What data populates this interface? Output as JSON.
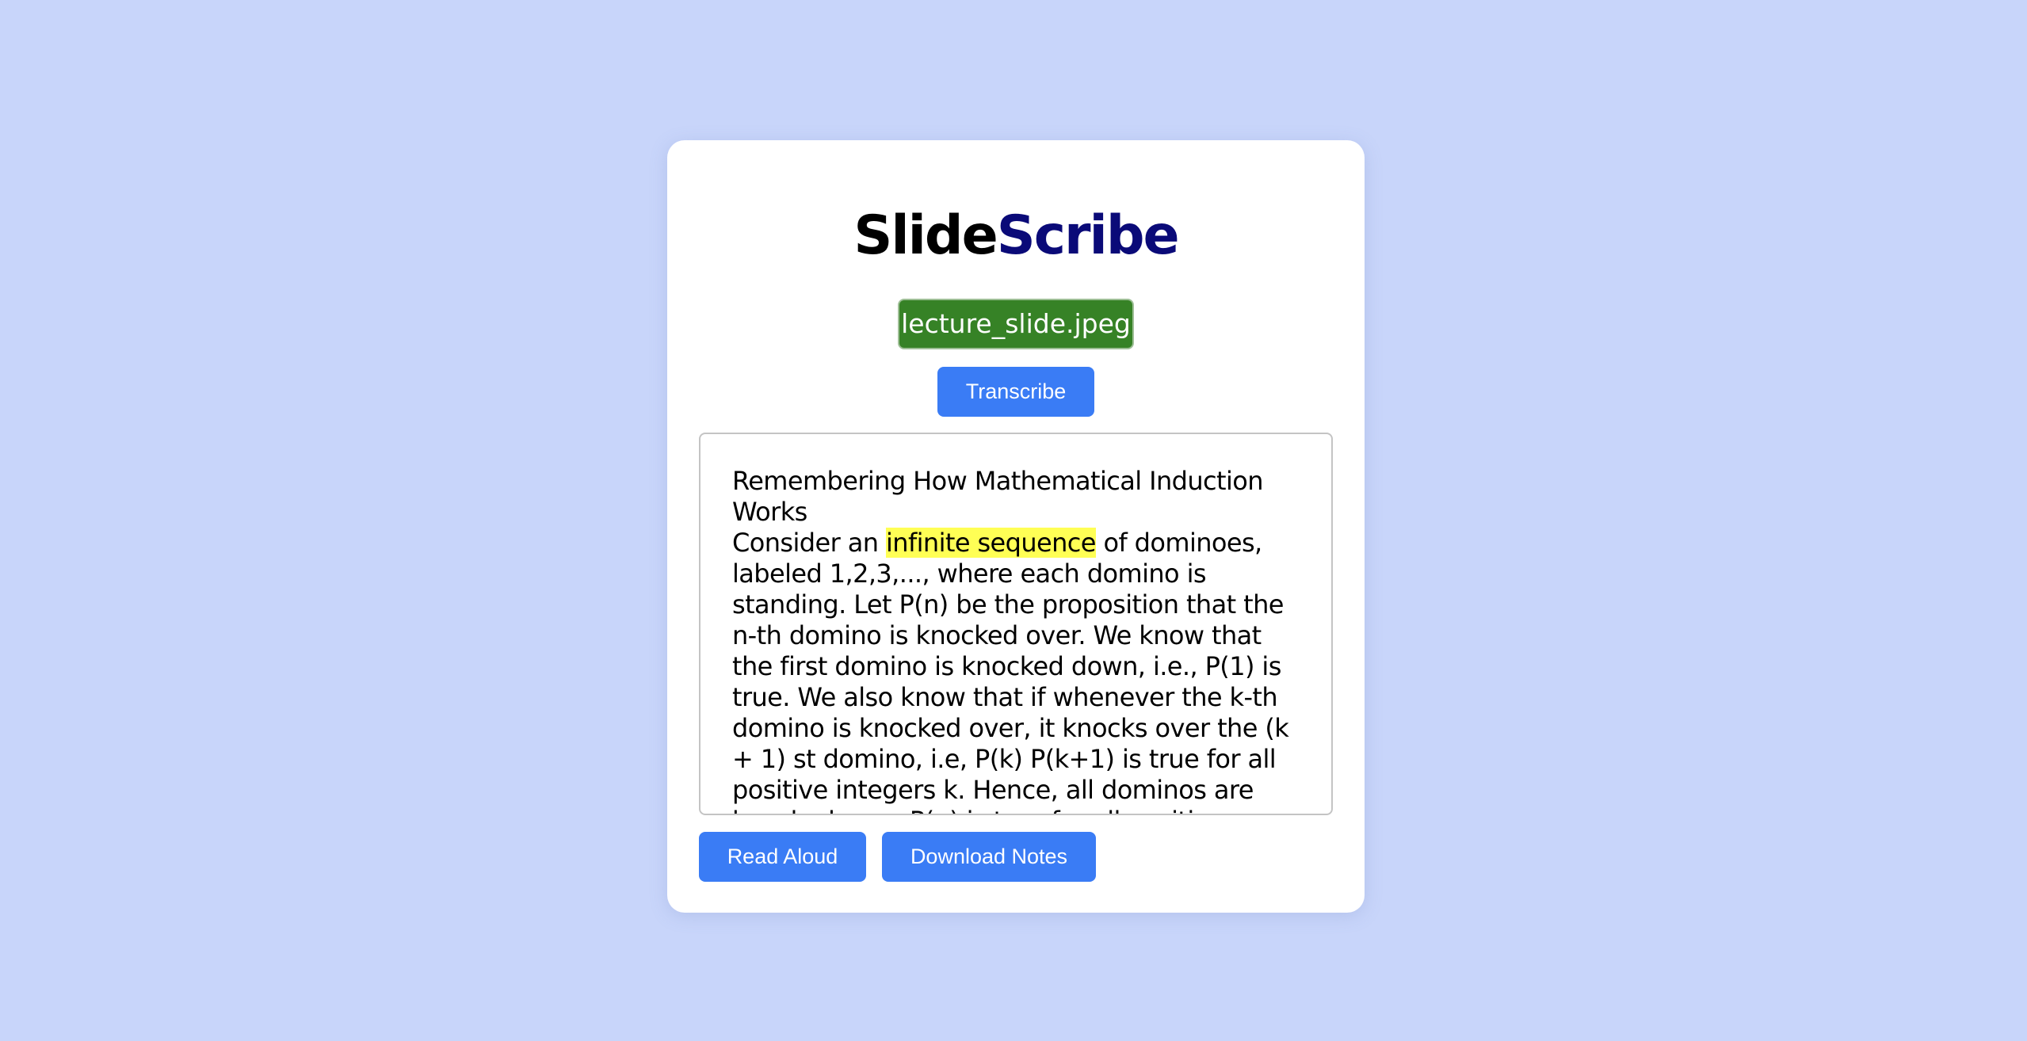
{
  "app": {
    "title_part_a": "Slide",
    "title_part_b": "Scribe"
  },
  "file": {
    "name": "lecture_slide.jpeg"
  },
  "actions": {
    "transcribe_label": "Transcribe",
    "read_aloud_label": "Read Aloud",
    "download_notes_label": "Download Notes"
  },
  "transcript": {
    "heading": "Remembering How Mathematical Induction Works",
    "before_highlight": "Consider an ",
    "highlighted": "infinite sequence",
    "after_highlight": " of dominoes, labeled 1,2,3,..., where each domino is standing. Let P(n) be the proposition that the n-th domino is knocked over. We know that the first domino is knocked down, i.e., P(1) is true. We also know that if whenever the k-th domino is knocked over, it knocks over the (k + 1) st domino, i.e, P(k) P(k+1) is true for all positive integers k. Hence, all dominos are knocked over. P(n) is true for all positive integers n."
  },
  "colors": {
    "background": "#c8d5fa",
    "title_accent": "#0a0a78",
    "file_chip": "#368226",
    "button": "#3a7cf5",
    "highlight": "#ffff55"
  }
}
